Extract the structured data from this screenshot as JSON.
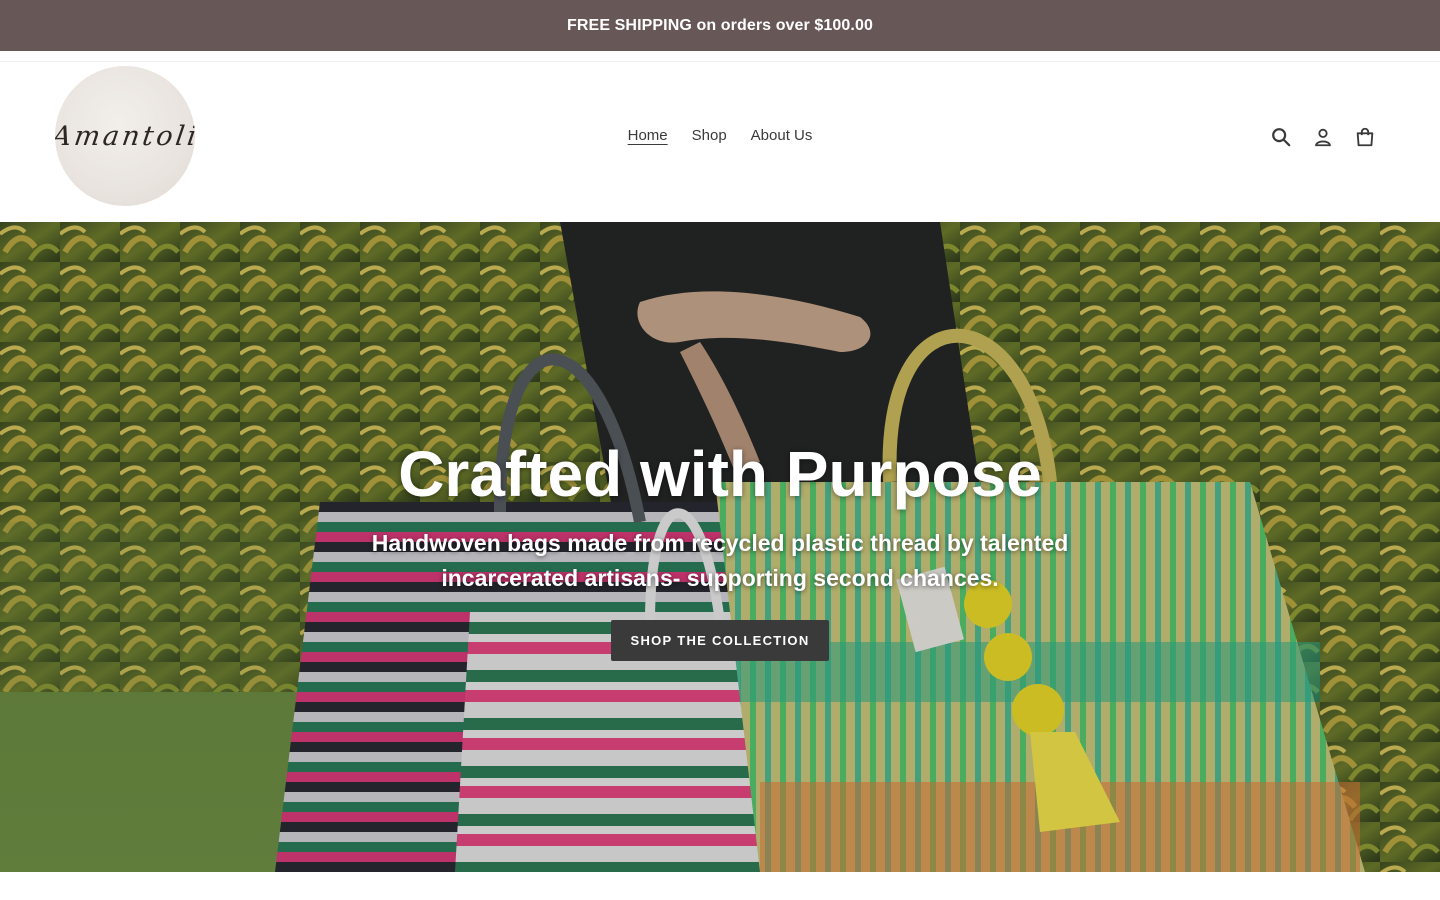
{
  "announcement": {
    "text": "FREE SHIPPING on orders over $100.00"
  },
  "header": {
    "logo_text": "Amantoli",
    "nav": [
      {
        "label": "Home",
        "active": true
      },
      {
        "label": "Shop",
        "active": false
      },
      {
        "label": "About Us",
        "active": false
      }
    ],
    "icons": [
      "search-icon",
      "account-icon",
      "cart-icon"
    ]
  },
  "hero": {
    "title": "Crafted with Purpose",
    "subtitle": "Handwoven bags made from recycled plastic thread by talented incarcerated artisans- supporting second chances.",
    "button_label": "SHOP THE COLLECTION"
  },
  "colors": {
    "announcement_bg": "#675757",
    "button_bg": "#3a3a3a",
    "text": "#3a3a3a"
  }
}
